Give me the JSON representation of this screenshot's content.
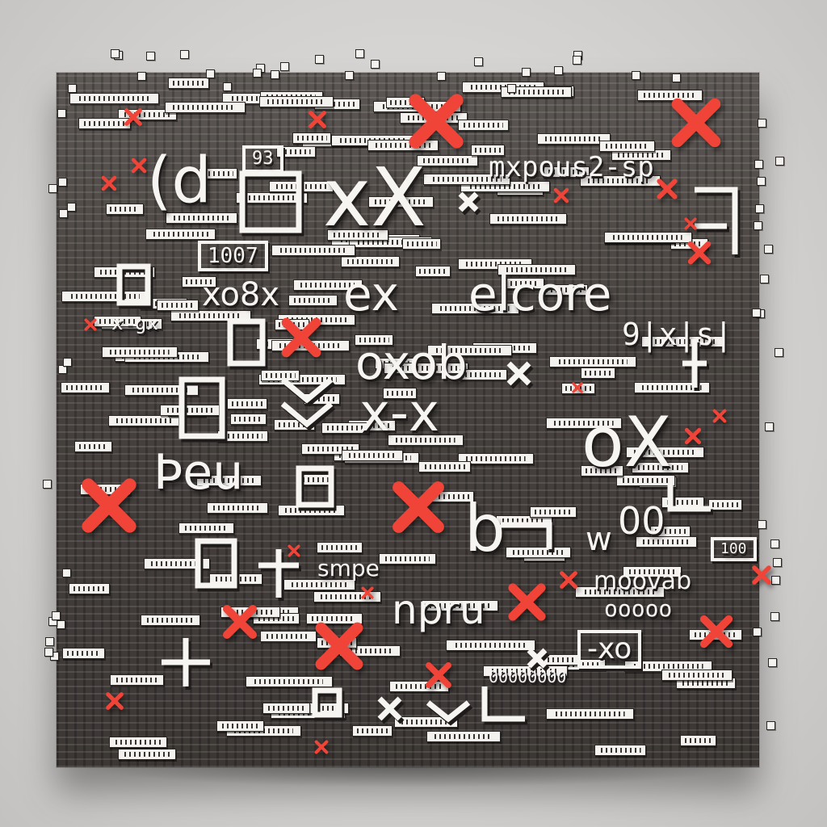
{
  "colors": {
    "background": "#d6d4d2",
    "block": "#4a4542",
    "glyph": "#f7f5f2",
    "cross": "#f04438"
  },
  "glyphs": {
    "t1": "(d",
    "t2": "93",
    "t3": "xX",
    "t4": "mxpous2-sp",
    "t5": "1007",
    "t6": "xo8x",
    "t7": "ex",
    "t8": "elcore",
    "t9": "x-gx",
    "t10": "9|x|s|",
    "t11": "oxob",
    "t12": "x-x",
    "t13": "Þeu",
    "t14": "oX",
    "t15": "smpe",
    "t16": "npru",
    "t17": "moovab",
    "t18": "ooooo",
    "t19": "-xo",
    "t20": "00000000",
    "t21": "00",
    "t22": "w",
    "t23": "100",
    "t24": "b"
  },
  "icons": {
    "cross": "red-x-icon"
  }
}
